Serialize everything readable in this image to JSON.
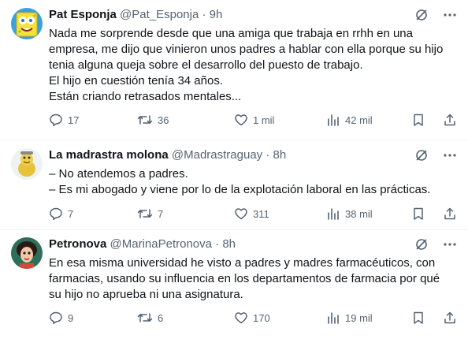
{
  "tweets": [
    {
      "name": "Pat Esponja",
      "handle": "@Pat_Esponja",
      "time": "· 9h",
      "avatar": "sponge-cartoon-avatar",
      "lines": [
        "Nada me sorprende desde que una amiga que trabaja en rrhh en una",
        "empresa, me dijo que vinieron unos padres a hablar con ella porque su hijo",
        "tenia alguna queja sobre el desarrollo del puesto de trabajo.",
        "El hijo en cuestión tenía 34 años.",
        "Están criando retrasados mentales..."
      ],
      "replies": "17",
      "reposts": "36",
      "likes": "1 mil",
      "views": "42 mil"
    },
    {
      "name": "La madrastra molona",
      "handle": "@Madrastraguay",
      "time": "· 8h",
      "avatar": "cartoon-character-avatar",
      "lines": [
        "– No atendemos a padres.",
        "– Es mi abogado y viene por lo de la explotación laboral en las prácticas."
      ],
      "replies": "7",
      "reposts": "7",
      "likes": "311",
      "views": "38 mil"
    },
    {
      "name": "Petronova",
      "handle": "@MarinaPetronova",
      "time": "· 8h",
      "avatar": "illustrated-woman-avatar",
      "lines": [
        "En esa misma universidad he visto a padres  y madres farmacéuticos, con",
        "farmacias, usando su influencia en los departamentos de farmacia por qué",
        "su hijo no aprueba ni una asignatura."
      ],
      "replies": "9",
      "reposts": "6",
      "likes": "170",
      "views": "19 mil"
    }
  ],
  "icons": {
    "reply": "reply-icon",
    "repost": "repost-icon",
    "like": "like-icon",
    "views": "views-icon",
    "bookmark": "bookmark-icon",
    "share": "share-icon",
    "grok": "grok-icon",
    "more": "more-icon"
  },
  "colors": {
    "text": "#0f1419",
    "secondary": "#536471",
    "divider": "#eff3f4"
  }
}
